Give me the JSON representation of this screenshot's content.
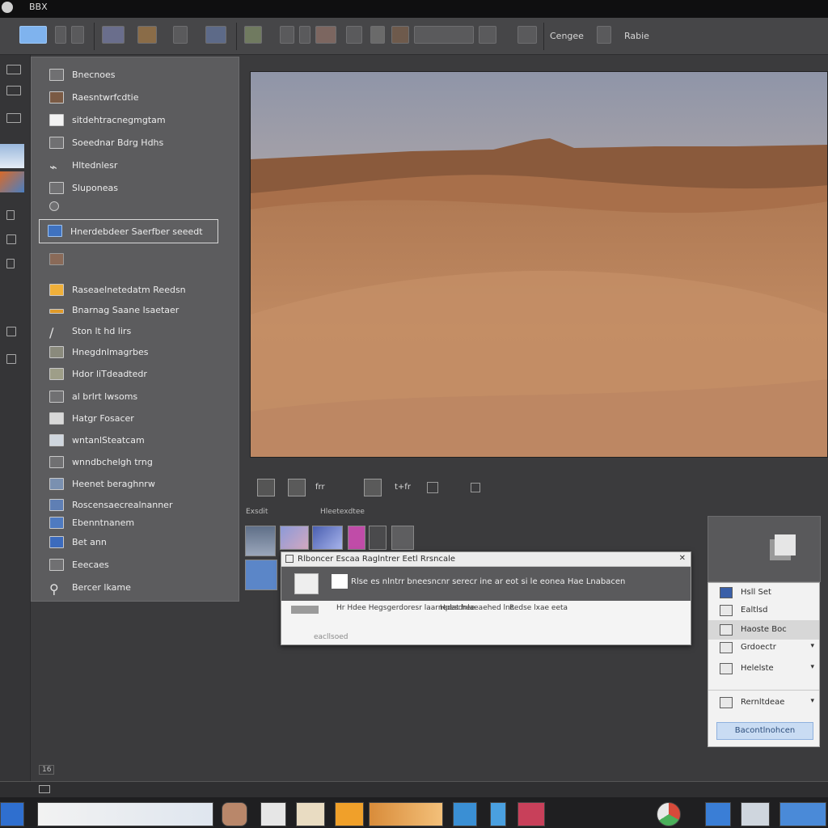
{
  "window": {
    "title": "BBX"
  },
  "toolbar": {
    "label_a": "Cengee",
    "label_b": "Rabie"
  },
  "menu": {
    "items": [
      {
        "label": "Bnecnoes"
      },
      {
        "label": "Raesntwrfcdtie"
      },
      {
        "label": "sitdehtracnegmgtam"
      },
      {
        "label": "Soeednar Bdrg Hdhs"
      },
      {
        "label": "Hltednlesr"
      },
      {
        "label": "Sluponeas"
      },
      {
        "label": ""
      },
      {
        "label": "Hnerdebdeer Saerfber seeedt"
      },
      {
        "label": ""
      },
      {
        "label": "Raseaelnetedatm Reedsn"
      },
      {
        "label": "Bnarnag Saane Isaetaer"
      },
      {
        "label": "Ston lt hd lirs"
      },
      {
        "label": "Hnegdnlmagrbes"
      },
      {
        "label": "Hdor liTdeadtedr"
      },
      {
        "label": "al brlrt lwsoms"
      },
      {
        "label": "Hatgr Fosacer"
      },
      {
        "label": "wntanlSteatcam"
      },
      {
        "label": "wnndbchelgh trng"
      },
      {
        "label": "Heenet beraghnrw"
      },
      {
        "label": "Roscensaecrealnanner"
      },
      {
        "label": "Ebenntnanem"
      },
      {
        "label": "Bet ann"
      },
      {
        "label": "Eeecaes"
      },
      {
        "label": "Bercer lkame"
      }
    ]
  },
  "preview_toolbar": {
    "coord": "frr",
    "text_b": "t+fr"
  },
  "filmstrip": {
    "label_left": "Exsdit",
    "label_right": "Hleetexdtee"
  },
  "dialog": {
    "title": "Rlboncer  Escaa  Raglntrer  Eetl  Rrsncale",
    "body": "Rlse es nlntrr bneesncnr serecr ine ar eot si le eonea Hae Lnabacen",
    "foot_a": "Hr Hdee Hegsgerdoresr laarnedat hee",
    "foot_b": "Hpesdnlaeaehed lnc",
    "foot_c": "Redse lxae eeta",
    "foot_d": "eacllsoed"
  },
  "flyout": {
    "items": [
      {
        "label": "Hsll Set"
      },
      {
        "label": "Ealtlsd"
      },
      {
        "label": "Haoste Boc"
      },
      {
        "label": "Grdoectr"
      },
      {
        "label": "Helelste"
      },
      {
        "label": "Rernltdeae"
      }
    ],
    "button": "Bacontlnohcen"
  },
  "status": {
    "page": "16"
  },
  "colors": {
    "accent": "#7fb3ee",
    "panel": "#5c5c5e",
    "background": "#3b3b3d"
  }
}
